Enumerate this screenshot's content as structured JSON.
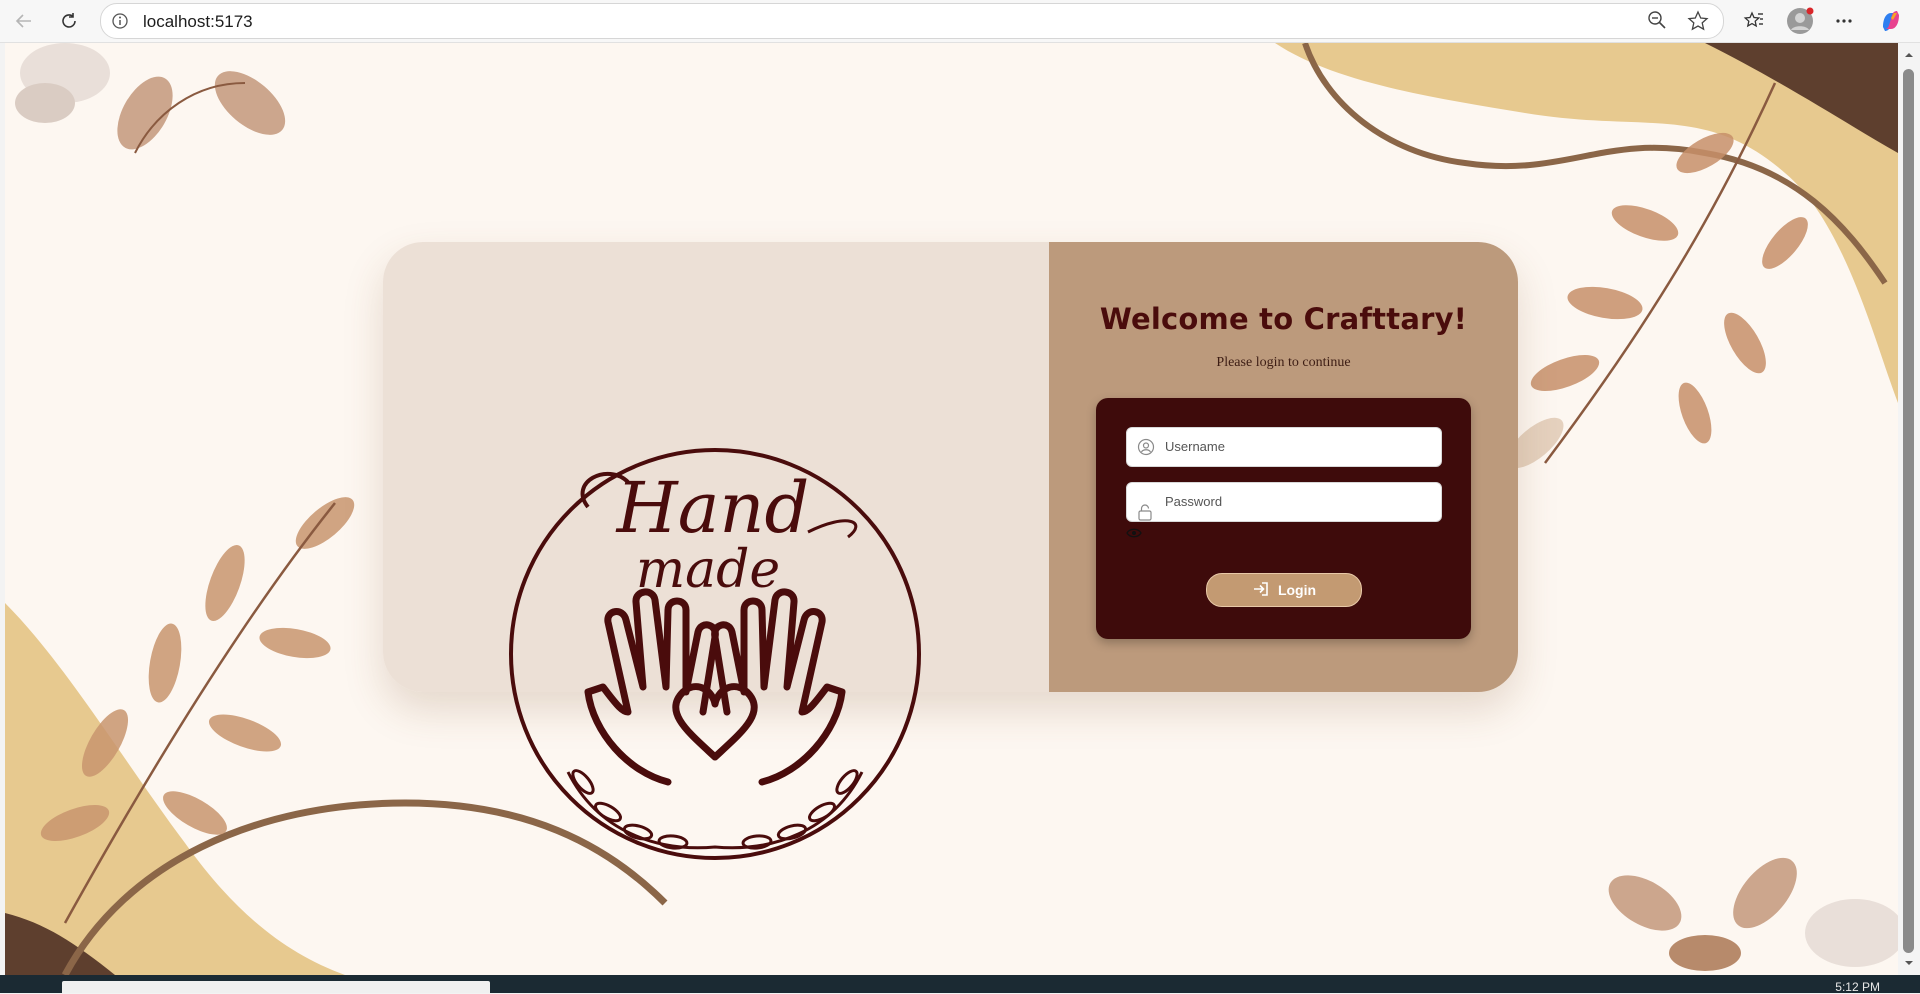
{
  "browser": {
    "url": "localhost:5173"
  },
  "login": {
    "title": "Welcome to Crafttary!",
    "subtitle": "Please login to continue",
    "username_placeholder": "Username",
    "password_placeholder": "Password",
    "login_label": "Login"
  },
  "logo": {
    "line1": "Hand",
    "line2": "made"
  },
  "taskbar": {
    "clock": "5:12 PM"
  },
  "colors": {
    "page_bg": "#fdf7f1",
    "card_left": "#ece0d6",
    "card_right": "#bc9a7c",
    "form_bg": "#3e0b0b",
    "title": "#4a0c0c",
    "button": "#c39a72"
  },
  "icons": [
    "back-icon",
    "refresh-icon",
    "site-info-icon",
    "zoom-out-icon",
    "favorite-star-icon",
    "favorites-icon",
    "profile-icon",
    "more-icon",
    "copilot-icon",
    "user-icon",
    "lock-icon",
    "eye-icon",
    "login-icon"
  ]
}
